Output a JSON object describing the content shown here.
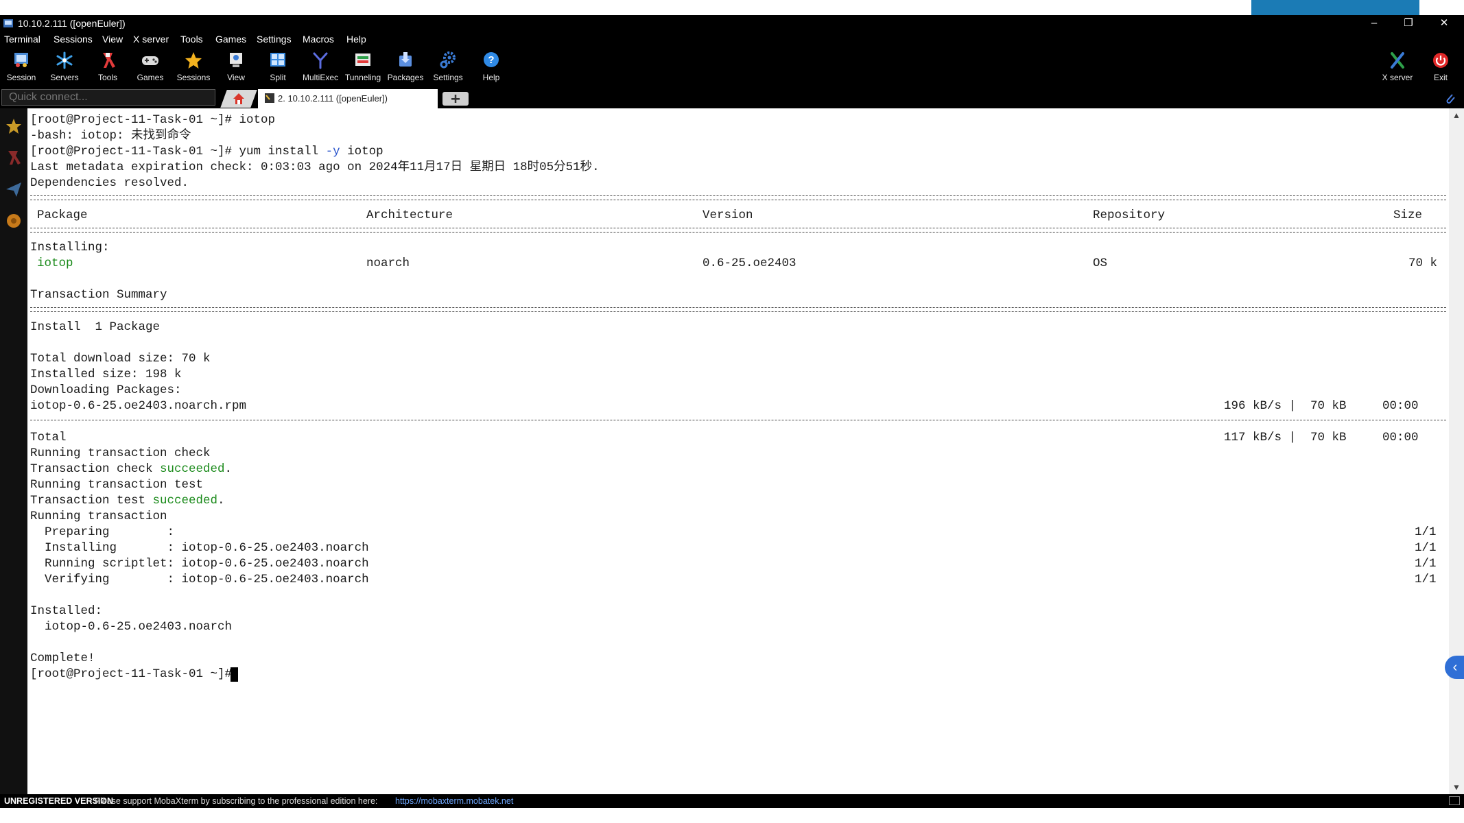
{
  "window": {
    "title": "10.10.2.111 ([openEuler])",
    "minimize": "–",
    "restore": "❐",
    "close": "✕"
  },
  "menu": [
    "Terminal",
    "Sessions",
    "View",
    "X server",
    "Tools",
    "Games",
    "Settings",
    "Macros",
    "Help"
  ],
  "toolbar": {
    "items": [
      "Session",
      "Servers",
      "Tools",
      "Games",
      "Sessions",
      "View",
      "Split",
      "MultiExec",
      "Tunneling",
      "Packages",
      "Settings",
      "Help"
    ],
    "xserver": "X server",
    "exit": "Exit"
  },
  "quick_connect": {
    "placeholder": "Quick connect..."
  },
  "tab": {
    "label": "2. 10.10.2.111 ([openEuler])"
  },
  "terminal": {
    "lines": {
      "l1": "[root@Project-11-Task-01 ~]# iotop",
      "l2": "-bash: iotop: 未找到命令",
      "l3_prompt": "[root@Project-11-Task-01 ~]# yum install ",
      "l3_flag": "-y",
      "l3_rest": " iotop",
      "l4": "Last metadata expiration check: 0:03:03 ago on 2024年11月17日 星期日 18时05分51秒.",
      "l5": "Dependencies resolved.",
      "installing": "Installing:",
      "summary": "Transaction Summary",
      "install_count": "Install  1 Package",
      "total_download": "Total download size: 70 k",
      "installed_size": "Installed size: 198 k",
      "downloading": "Downloading Packages:",
      "rpm_file": "iotop-0.6-25.oe2403.noarch.rpm",
      "rpm_stats": "196 kB/s |  70 kB     00:00",
      "total": "Total",
      "total_stats": "117 kB/s |  70 kB     00:00",
      "running_check": "Running transaction check",
      "check_prefix": "Transaction check ",
      "succeeded": "succeeded",
      "period": ".",
      "running_test": "Running transaction test",
      "test_prefix": "Transaction test ",
      "running_tx": "Running transaction",
      "preparing": "  Preparing        :",
      "installing_step": "  Installing       : iotop-0.6-25.oe2403.noarch",
      "scriptlet": "  Running scriptlet: iotop-0.6-25.oe2403.noarch",
      "verifying": "  Verifying        : iotop-0.6-25.oe2403.noarch",
      "progress": "1/1",
      "installed": "Installed:",
      "installed_pkg": "  iotop-0.6-25.oe2403.noarch",
      "complete": "Complete!",
      "final_prompt": "[root@Project-11-Task-01 ~]# "
    },
    "table": {
      "headers": [
        "Package",
        "Architecture",
        "Version",
        "Repository",
        "Size"
      ],
      "row": [
        "iotop",
        "noarch",
        "0.6-25.oe2403",
        "OS",
        "70 k"
      ]
    }
  },
  "statusbar": {
    "unregistered": "UNREGISTERED VERSION",
    "message": " -  Please support MobaXterm by subscribing to the professional edition here: ",
    "link": "https://mobaxterm.mobatek.net"
  },
  "colors": {
    "success": "#1a8a1a",
    "flag": "#2a55cc",
    "accent": "#2f6fd6"
  }
}
